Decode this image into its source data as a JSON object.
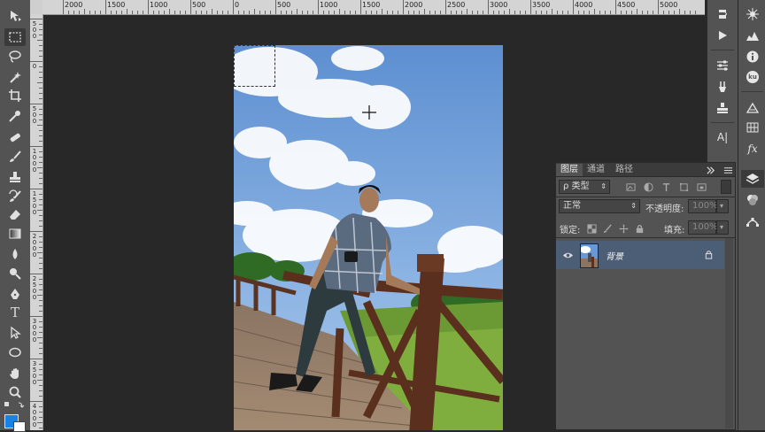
{
  "ruler": {
    "h_labels": [
      "2000",
      "1500",
      "1000",
      "500",
      "0",
      "500",
      "1000",
      "1500",
      "2000",
      "2500",
      "3000",
      "3500",
      "4000",
      "4500",
      "5000"
    ],
    "v_labels": [
      "500",
      "0",
      "500",
      "1000",
      "1500",
      "2000",
      "2500",
      "3000",
      "3500",
      "4000"
    ]
  },
  "tools": [
    "move-tool",
    "marquee-tool",
    "lasso-tool",
    "magic-wand-tool",
    "crop-tool",
    "eyedropper-tool",
    "healing-brush-tool",
    "brush-tool",
    "clone-stamp-tool",
    "history-brush-tool",
    "eraser-tool",
    "gradient-tool",
    "blur-tool",
    "dodge-tool",
    "pen-tool",
    "type-tool",
    "path-selection-tool",
    "ellipse-tool",
    "hand-tool",
    "zoom-tool"
  ],
  "tool_glyphs": {
    "type": "T"
  },
  "colors": {
    "foreground": "#1a82e3",
    "background": "#ffffff",
    "layer_selected": "#4c5e75"
  },
  "layers_panel": {
    "tabs": [
      "图层",
      "通道",
      "路径"
    ],
    "filter": {
      "label": "ρ 类型"
    },
    "blend_mode": "正常",
    "opacity_label": "不透明度:",
    "opacity_value": "100%",
    "lock_label": "锁定:",
    "fill_label": "填充:",
    "fill_value": "100%",
    "layer": {
      "name": "背景"
    }
  },
  "dock_glyphs": {
    "ku": "ku",
    "text": "A|",
    "fx": "fx"
  }
}
